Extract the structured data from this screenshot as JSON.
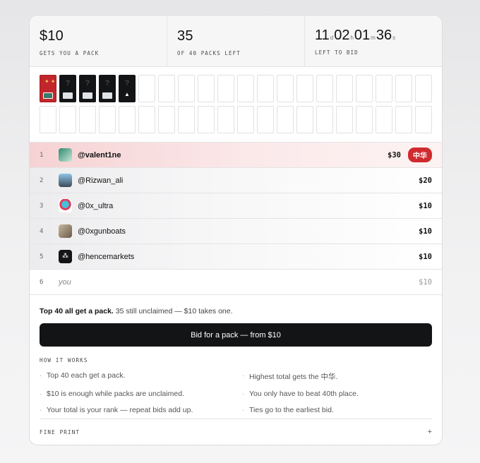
{
  "stats": {
    "price": "$10",
    "price_label": "GETS YOU A PACK",
    "packs_count": "35",
    "packs_label": "OF 40 PACKS LEFT",
    "countdown": [
      {
        "value": "11",
        "unit": "d"
      },
      {
        "value": "02",
        "unit": "h"
      },
      {
        "value": "01",
        "unit": "m"
      },
      {
        "value": "36",
        "unit": "s"
      }
    ],
    "countdown_label": "LEFT TO BID"
  },
  "packs": {
    "total": 40,
    "claimed": [
      {
        "style": "red"
      },
      {
        "style": "black",
        "mark": "?"
      },
      {
        "style": "black",
        "mark": "?"
      },
      {
        "style": "black",
        "mark": "?"
      },
      {
        "style": "black",
        "mark": "?"
      }
    ]
  },
  "leaderboard": [
    {
      "rank": "1",
      "handle": "@valent1ne",
      "amount": "$30",
      "badge": "中华",
      "avatar": "green"
    },
    {
      "rank": "2",
      "handle": "@Rizwan_ali",
      "amount": "$20",
      "avatar": "sky"
    },
    {
      "rank": "3",
      "handle": "@0x_ultra",
      "amount": "$10",
      "avatar": "cartoon"
    },
    {
      "rank": "4",
      "handle": "@0xgunboats",
      "amount": "$10",
      "avatar": "photo"
    },
    {
      "rank": "5",
      "handle": "@hencemarkets",
      "amount": "$10",
      "avatar": "black"
    },
    {
      "rank": "6",
      "handle": "you",
      "amount": "$10",
      "avatar": ""
    }
  ],
  "summary": {
    "strong": "Top 40 all get a pack.",
    "rest": " 35 still unclaimed — $10 takes one."
  },
  "bid_button": "Bid for a pack — from $10",
  "how_it_works": {
    "title": "HOW IT WORKS",
    "rules": [
      "Top 40 each get a pack.",
      "Highest total gets the 中华.",
      "$10 is enough while packs are unclaimed.",
      "You only have to beat 40th place.",
      "Your total is your rank — repeat bids add up.",
      "Ties go to the earliest bid."
    ]
  },
  "fine_print": {
    "title": "FINE PRINT",
    "toggle": "+"
  }
}
